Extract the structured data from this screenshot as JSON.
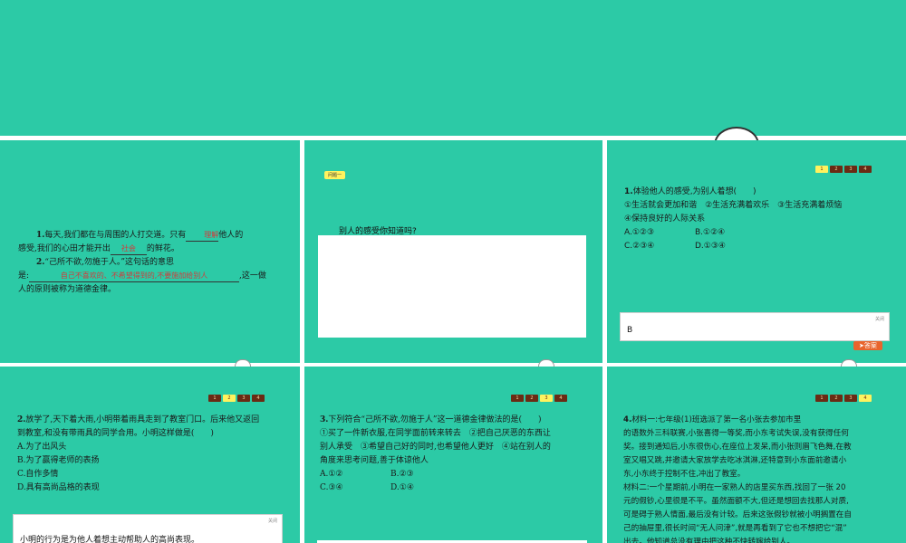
{
  "slide1": {
    "line1_pre": "1.",
    "line1_text": "每天,我们都在与周围的人打交道。只有",
    "blank1": "理解",
    "line1_post": "他人的",
    "line2_text": "感受,我们的心田才能开出",
    "blank2": "社会",
    "line2_post": "的鲜花。",
    "line3_pre": "2.",
    "line3_text": "“己所不欲,勿施于人。”这句话的意思",
    "line4_text": "是:",
    "blank3": "自己不喜欢的、不希望得到的,不要施加给别人",
    "line4_post": ",这一做",
    "line5_text": "人的原则被称为道德金律。"
  },
  "slide2": {
    "badge": "问题一",
    "question": "别人的感受你知道吗?"
  },
  "slide3": {
    "pager": [
      "1",
      "2",
      "3",
      "4"
    ],
    "active_page": "1",
    "q_num": "1.",
    "q_text": "体验他人的感受,为别人着想(　　)",
    "opt_line1": "①生活就会更加和谐　②生活充满着欢乐　③生活充满着烦恼",
    "opt_line2": "④保持良好的人际关系",
    "choice_a": "A.①②③",
    "choice_b": "B.①②④",
    "choice_c": "C.②③④",
    "choice_d": "D.①③④",
    "close_label": "关闭",
    "answer": "B",
    "answer_button": "答案"
  },
  "slide4": {
    "pager": [
      "1",
      "2",
      "3",
      "4"
    ],
    "active_page": "2",
    "q_num": "2.",
    "q_line1": "放学了,天下着大雨,小明带着雨具走到了教室门口。后来他又返回",
    "q_line2": "到教室,和没有带雨具的同学合用。小明这样做是(　　)",
    "choice_a": "A.为了出风头",
    "choice_b": "B.为了赢得老师的表扬",
    "choice_c": "C.自作多情",
    "choice_d": "D.具有高尚品格的表现",
    "close_label": "关闭",
    "answer_text": "小明的行为是为他人着想主动帮助人的高尚表现。"
  },
  "slide5": {
    "pager": [
      "1",
      "2",
      "3",
      "4"
    ],
    "active_page": "3",
    "q_num": "3.",
    "q_line1": "下列符合“己所不欲,勿施于人”这一道德金律做法的是(　　)",
    "q_line2": "①买了一件新衣服,在同学面前转来转去　②把自己厌恶的东西让",
    "q_line3": "别人承受　③希望自己好的同时,也希望他人更好　④站在别人的",
    "q_line4": "角度来思考问题,善于体谅他人",
    "choice_a": "A.①②",
    "choice_b": "B.②③",
    "choice_c": "C.③④",
    "choice_d": "D.①④"
  },
  "slide6": {
    "pager": [
      "1",
      "2",
      "3",
      "4"
    ],
    "active_page": "4",
    "q_num": "4.",
    "line1": "材料一:七年级(1)班选派了第一名小张去参加市里",
    "line2": "的语数外三科联赛,小张喜得一等奖,而小东考试失误,没有获得任何",
    "line3": "奖。接到通知后,小东很伤心,在座位上发呆,而小张则眉飞色舞,在教",
    "line4": "室又唱又跳,并邀请大家放学去吃冰淇淋,还特意到小东面前邀请小",
    "line5": "东,小东终于控制不住,冲出了教室。",
    "line6": "材料二:一个星期前,小明在一家熟人的店里买东西,找回了一张 20",
    "line7": "元的假钞,心里很是不平。虽然面额不大,但还是想回去找那人对质,",
    "line8": "可是碍于熟人情面,最后没有计较。后来这张假钞就被小明搁置在自",
    "line9": "己的抽屉里,很长时间“无人问津”,就是再看到了它也不想把它“混”",
    "line10": "出去。他知道总没有理由把这种不快转嫁给别人。"
  }
}
